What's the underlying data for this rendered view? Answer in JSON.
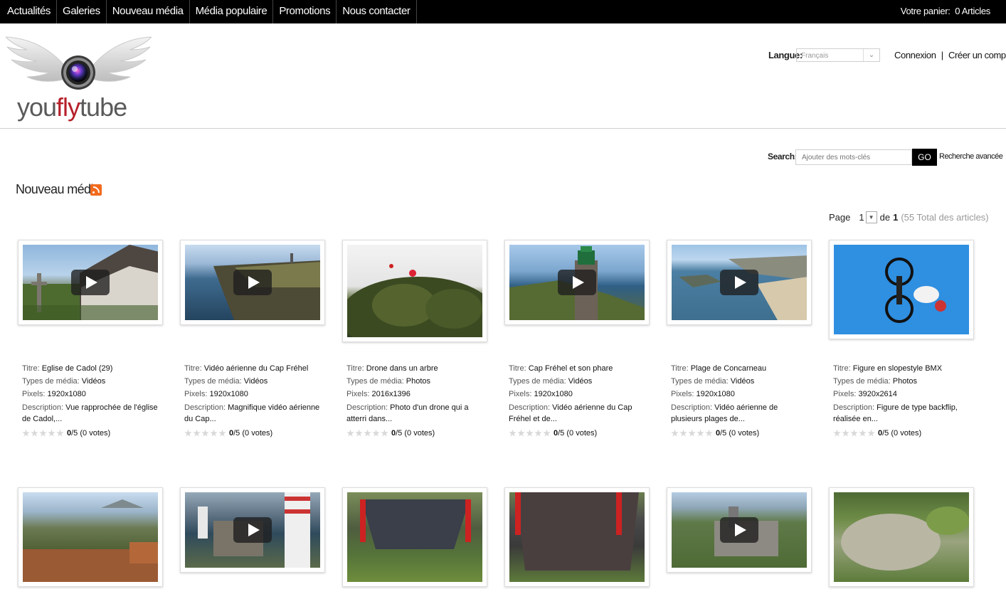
{
  "nav": {
    "items": [
      "Actualités",
      "Galeries",
      "Nouveau média",
      "Média populaire",
      "Promotions",
      "Nous contacter"
    ],
    "cart_label": "Votre panier:",
    "cart_value": "0 Articles"
  },
  "header": {
    "logo_text_1": "you",
    "logo_text_2": "fly",
    "logo_text_3": "tube",
    "language_label": "Langue:",
    "language_value": "Français",
    "login": "Connexion",
    "separator": "|",
    "register": "Créer un compte"
  },
  "search": {
    "label": "Search:",
    "placeholder": "Ajouter des mots-clés",
    "go": "GO",
    "advanced": "Recherche avancée"
  },
  "section": {
    "title": "Nouveau média"
  },
  "pagination": {
    "page_label": "Page",
    "current": "1",
    "of_label": "de",
    "last": "1",
    "total": "(55 Total des articles)"
  },
  "labels": {
    "title": "Titre:",
    "type": "Types de média:",
    "pixels": "Pixels:",
    "description": "Description:"
  },
  "cards": [
    {
      "title": "Eglise de Cadol (29)",
      "type": "Vidéos",
      "pixels": "1920x1080",
      "desc": "Vue rapprochée de l'église de Cadol,...",
      "score": "0",
      "of": "/5",
      "votes": "(0 votes)"
    },
    {
      "title": "Vidéo aérienne du Cap Fréhel",
      "type": "Vidéos",
      "pixels": "1920x1080",
      "desc": "Magnifique vidéo aérienne du Cap...",
      "score": "0",
      "of": "/5",
      "votes": "(0 votes)"
    },
    {
      "title": "Drone dans un arbre",
      "type": "Photos",
      "pixels": "2016x1396",
      "desc": "Photo d'un drone qui a atterri dans...",
      "score": "0",
      "of": "/5",
      "votes": "(0 votes)"
    },
    {
      "title": "Cap Fréhel et son phare",
      "type": "Vidéos",
      "pixels": "1920x1080",
      "desc": "Vidéo aérienne du Cap Fréhel et de...",
      "score": "0",
      "of": "/5",
      "votes": "(0 votes)"
    },
    {
      "title": "Plage de Concarneau",
      "type": "Vidéos",
      "pixels": "1920x1080",
      "desc": "Vidéo aérienne de plusieurs plages de...",
      "score": "0",
      "of": "/5",
      "votes": "(0 votes)"
    },
    {
      "title": "Figure en slopestyle BMX",
      "type": "Photos",
      "pixels": "3920x2614",
      "desc": "Figure de type backflip, réalisée en...",
      "score": "0",
      "of": "/5",
      "votes": "(0 votes)"
    }
  ]
}
